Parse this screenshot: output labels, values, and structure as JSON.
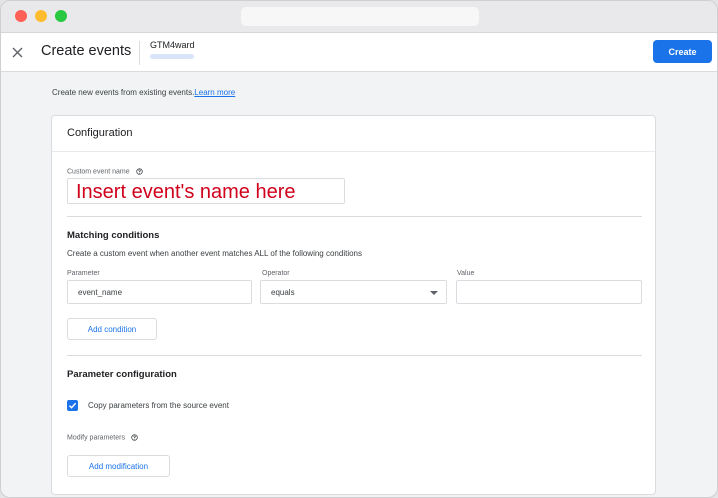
{
  "header": {
    "title": "Create events",
    "account_name": "GTM4ward",
    "create_label": "Create"
  },
  "intro": {
    "text": "Create new events from existing events.",
    "learn_more": "Learn more"
  },
  "configuration": {
    "title": "Configuration",
    "custom_event_name_label": "Custom event name",
    "custom_event_name_value": "Insert event's name here"
  },
  "matching": {
    "title": "Matching conditions",
    "description": "Create a custom event when another event matches ALL of the following conditions",
    "parameter_label": "Parameter",
    "operator_label": "Operator",
    "value_label": "Value",
    "parameter_value": "event_name",
    "operator_value": "equals",
    "value_value": "",
    "add_condition_label": "Add condition"
  },
  "parameter_config": {
    "title": "Parameter configuration",
    "copy_params_label": "Copy parameters from the source event",
    "copy_params_checked": true,
    "modify_params_label": "Modify parameters",
    "add_modification_label": "Add modification"
  },
  "colors": {
    "accent": "#1a73e8",
    "annotation": "#d0021b"
  }
}
